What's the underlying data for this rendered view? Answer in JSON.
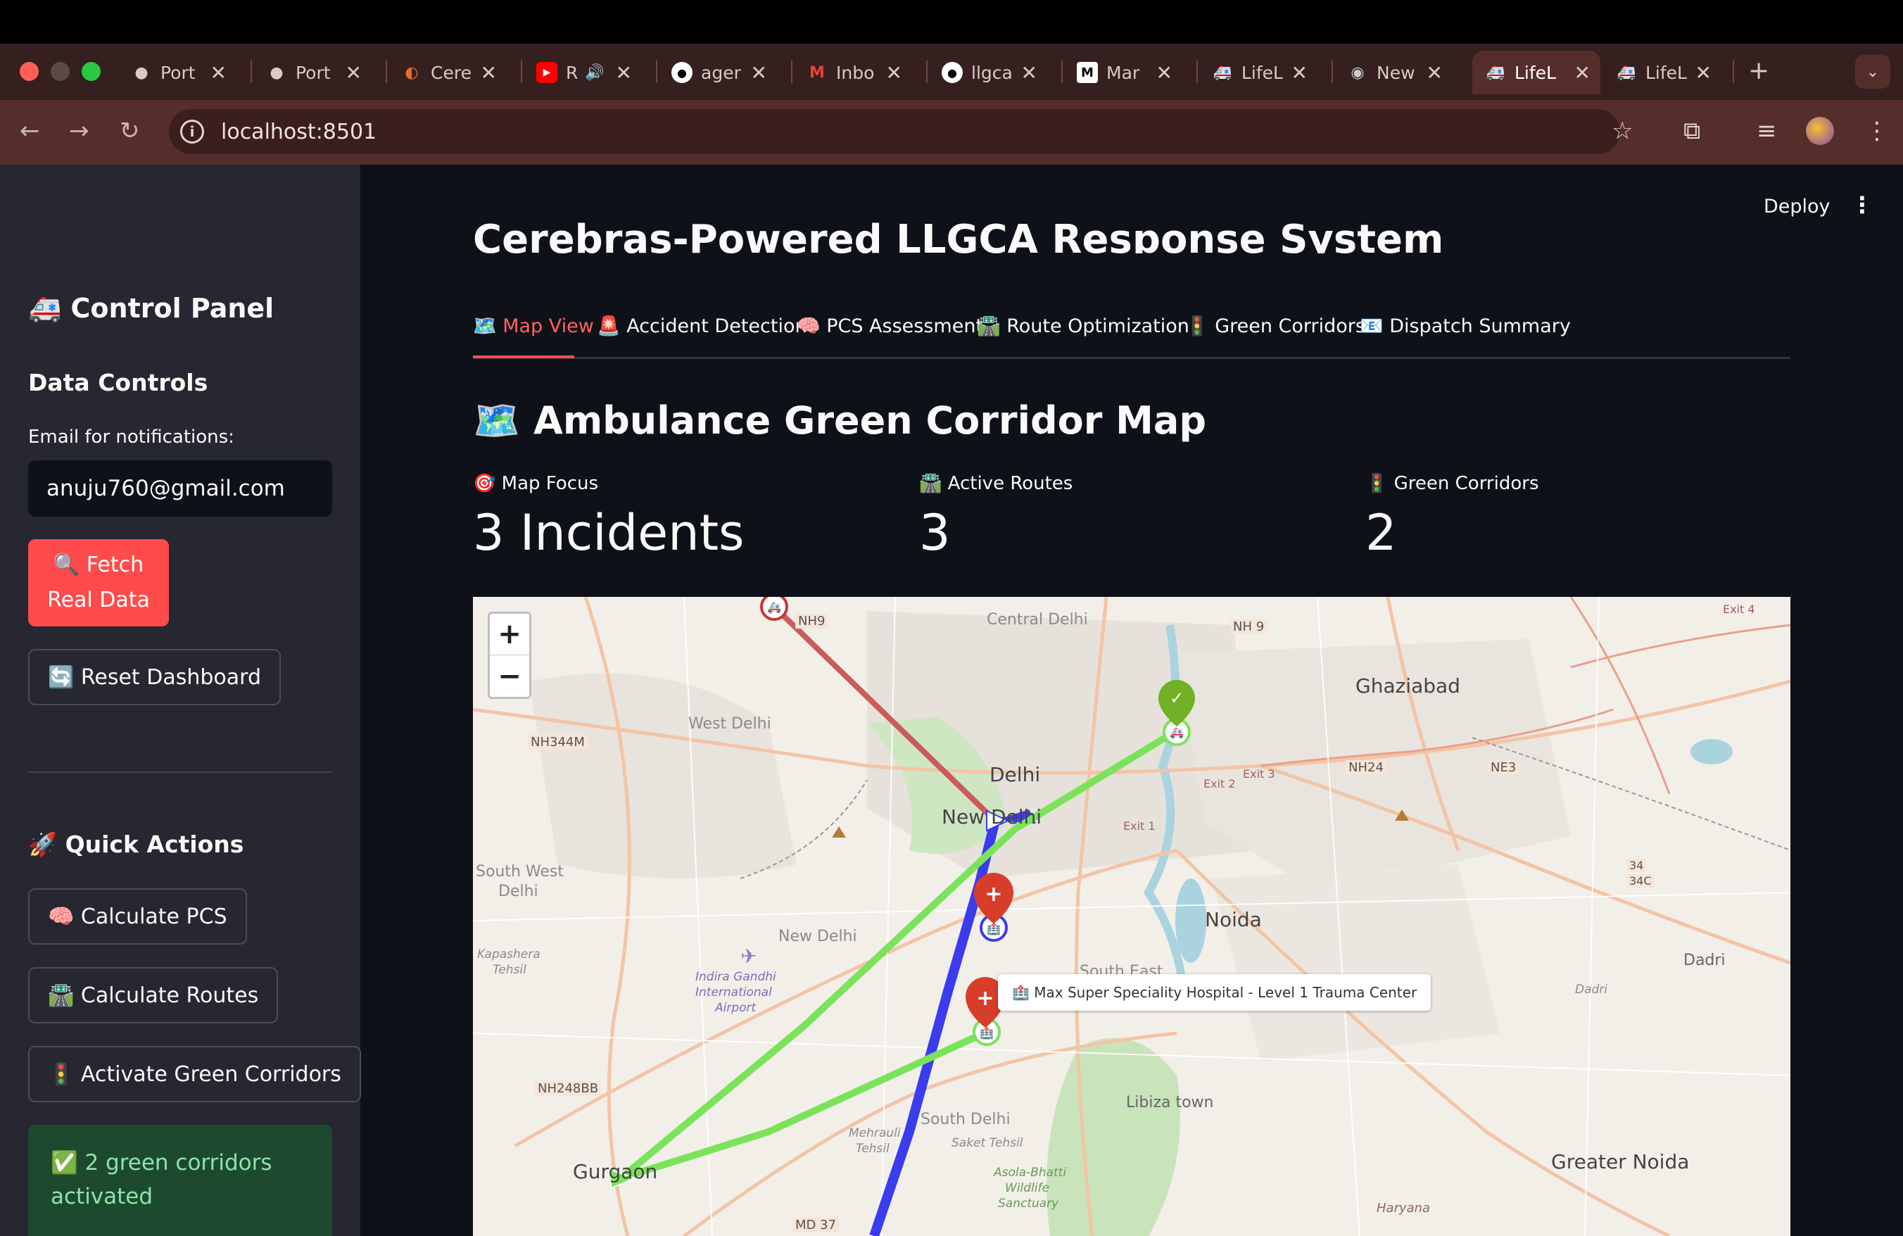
{
  "browser": {
    "tabs": [
      {
        "label": "Port",
        "icon": "portfolio-icon"
      },
      {
        "label": "Port",
        "icon": "portfolio-icon"
      },
      {
        "label": "Cere",
        "icon": "cerebras-icon"
      },
      {
        "label": "R",
        "icon": "youtube-icon"
      },
      {
        "label": "ager",
        "icon": "github-icon"
      },
      {
        "label": "Inbo",
        "icon": "gmail-icon"
      },
      {
        "label": "llgca",
        "icon": "github-icon"
      },
      {
        "label": "Mar",
        "icon": "medium-icon"
      },
      {
        "label": "LifeL",
        "icon": "ambulance-icon"
      },
      {
        "label": "New",
        "icon": "chrome-icon"
      },
      {
        "label": "LifeL",
        "icon": "ambulance-icon"
      },
      {
        "label": "LifeL",
        "icon": "ambulance-icon"
      }
    ],
    "url": "localhost:8501"
  },
  "sidebar": {
    "title": "🚑 Control Panel",
    "data_controls": "Data Controls",
    "email_label": "Email for notifications:",
    "email_value": "anuju760@gmail.com",
    "fetch_line1": "🔍 Fetch",
    "fetch_line2": "Real Data",
    "reset": "🔄 Reset Dashboard",
    "quick_actions": "🚀 Quick Actions",
    "calc_pcs": "🧠 Calculate PCS",
    "calc_routes": "🛣️ Calculate Routes",
    "activate": "🚦 Activate Green Corridors",
    "success_line1": "✅ 2 green corridors",
    "success_line2": "activated"
  },
  "header": {
    "deploy": "Deploy",
    "title": "Cerebras-Powered LLGCA Response System"
  },
  "tabs": [
    {
      "label": "🗺️ Map View"
    },
    {
      "label": "🚨 Accident Detection"
    },
    {
      "label": "🧠 PCS Assessment"
    },
    {
      "label": "🛣️ Route Optimization"
    },
    {
      "label": "🚦 Green Corridors"
    },
    {
      "label": "📧 Dispatch Summary"
    }
  ],
  "main": {
    "heading": "🗺️ Ambulance Green Corridor Map",
    "metrics": [
      {
        "label": "🎯 Map Focus",
        "value": "3 Incidents"
      },
      {
        "label": "🛣️ Active Routes",
        "value": "3"
      },
      {
        "label": "🚦 Green Corridors",
        "value": "2"
      }
    ]
  },
  "map": {
    "zoom_in": "+",
    "zoom_out": "−",
    "tooltip": "🏥 Max Super Speciality Hospital - Level 1 Trauma Center",
    "labels": {
      "central_delhi": "Central Delhi",
      "nh9_top": "NH9",
      "nh_9": "NH 9",
      "ghaziabad": "Ghaziabad",
      "west_delhi": "West Delhi",
      "nh344m": "NH344M",
      "delhi": "Delhi",
      "new_delhi_city": "New Delhi",
      "nh24": "NH24",
      "ne3": "NE3",
      "exit2": "Exit 2",
      "exit3": "Exit 3",
      "exit1": "Exit 1",
      "exit4": "Exit 4",
      "south_west": "South West",
      "delhi_sw": "Delhi",
      "new_delhi_district": "New Delhi",
      "noida": "Noida",
      "kapashera": "Kapashera",
      "tehsil": "Tehsil",
      "igi1": "Indira Gandhi",
      "igi2": "International",
      "igi3": "Airport",
      "south_east": "South East",
      "dadri": "Dadri",
      "dadri2": "Dadri",
      "nh248bb": "NH248BB",
      "south_delhi": "South Delhi",
      "saket": "Saket Tehsil",
      "libiza": "Libiza town",
      "gurgaon": "Gurgaon",
      "asola1": "Asola-Bhatti",
      "asola2": "Wildlife",
      "asola3": "Sanctuary",
      "greater_noida": "Greater Noida",
      "haryana": "Haryana",
      "md37": "MD 37",
      "nh34": "34",
      "nh34c": "34C",
      "mehrauli": "Mehrauli",
      "tehsil2": "Tehsil"
    }
  },
  "colors": {
    "accent": "#ff4b4b",
    "green_route": "#7be35a",
    "blue_route": "#3b3bf0",
    "red_route": "#cc5b5b"
  }
}
